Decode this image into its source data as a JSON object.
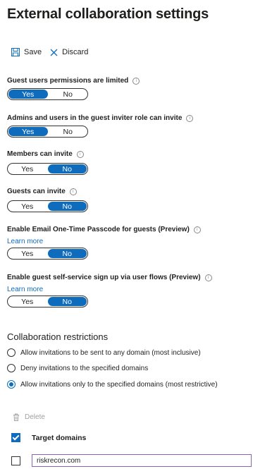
{
  "page": {
    "title": "External collaboration settings"
  },
  "toolbar": {
    "save_label": "Save",
    "discard_label": "Discard"
  },
  "settings": [
    {
      "label": "Guest users permissions are limited",
      "yes": "Yes",
      "no": "No",
      "selected": "Yes"
    },
    {
      "label": "Admins and users in the guest inviter role can invite",
      "yes": "Yes",
      "no": "No",
      "selected": "Yes"
    },
    {
      "label": "Members can invite",
      "yes": "Yes",
      "no": "No",
      "selected": "No"
    },
    {
      "label": "Guests can invite",
      "yes": "Yes",
      "no": "No",
      "selected": "No"
    },
    {
      "label": "Enable Email One-Time Passcode for guests (Preview)",
      "link": "Learn more",
      "yes": "Yes",
      "no": "No",
      "selected": "No"
    },
    {
      "label": "Enable guest self-service sign up via user flows (Preview)",
      "link": "Learn more",
      "yes": "Yes",
      "no": "No",
      "selected": "No"
    }
  ],
  "collaboration": {
    "title": "Collaboration restrictions",
    "options": [
      {
        "label": "Allow invitations to be sent to any domain (most inclusive)",
        "checked": false
      },
      {
        "label": "Deny invitations to the specified domains",
        "checked": false
      },
      {
        "label": "Allow invitations only to the specified domains (most restrictive)",
        "checked": true
      }
    ],
    "delete_label": "Delete",
    "target_header": "Target domains",
    "domains": [
      "riskrecon.com"
    ]
  },
  "colors": {
    "accent": "#0f6cbd",
    "input_border": "#8764b8"
  }
}
